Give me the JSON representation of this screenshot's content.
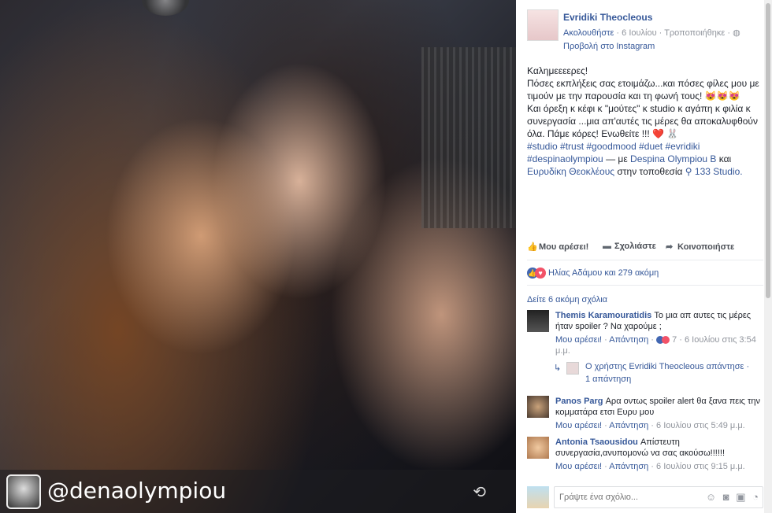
{
  "photo": {
    "watermark_handle": "@denaolympiou"
  },
  "header": {
    "page_name": "Evridiki Theocleous",
    "follow": "Ακολουθήστε",
    "date": "6 Ιουλίου",
    "edited": "Τροποποιήθηκε",
    "instagram_link": "Προβολή στο Instagram"
  },
  "post": {
    "line1": "Καλημεεεερες!",
    "line2": "Πόσες εκπλήξεις σας ετοιμάζω...και πόσες φίλες μου με τιμούν με την παρουσία και τη φωνή τους! 😻😻😻",
    "line3": "Και όρεξη κ κέφι κ \"μούτες\" κ studio κ αγάπη κ φιλία κ συνεργασία ...μια απ'αυτές τις μέρες θα αποκαλυφθούν όλα. Πάμε κόρες! Ενωθείτε !!! ❤️ 🐰",
    "hashtags": "#studio #trust #goodmood #duet #evridiki #despinaolympiou",
    "with_prefix": "— με",
    "tag1": "Despina Olympiou B",
    "and": "και",
    "tag2": "Ευρυδίκη Θεοκλέους",
    "location_prefix": "στην τοποθεσία",
    "location": "133 Studio."
  },
  "actions": {
    "like": "Μου αρέσει!",
    "comment": "Σχολιάστε",
    "share": "Κοινοποιήστε"
  },
  "reactions_text": "Ηλίας Αδάμου και 279 ακόμη",
  "more_comments": "Δείτε 6 ακόμη σχόλια",
  "comments": [
    {
      "author": "Themis Karamouratidis",
      "text": "Το μια απ αυτες τις μέρες ήταν spoiler ? Να χαρούμε ;",
      "like": "Μου αρέσει!",
      "reply": "Απάντηση",
      "reactions": "7",
      "time": "6 Ιουλίου στις 3:54 μ.μ."
    },
    {
      "author": "Panos Parg",
      "text": "Αρα οντως spoiler alert θα ξανα πεις την κομματάρα ετσι Ευρυ μου",
      "like": "Μου αρέσει!",
      "reply": "Απάντηση",
      "time": "6 Ιουλίου στις 5:49 μ.μ."
    },
    {
      "author": "Antonia Tsaousidou",
      "text": "Απίστευτη συνεργασία,ανυπομονώ να σας ακούσω!!!!!!",
      "like": "Μου αρέσει!",
      "reply": "Απάντηση",
      "time": "6 Ιουλίου στις 9:15 μ.μ."
    }
  ],
  "reply_thread": {
    "text": "Ο χρήστης Evridiki Theocleous απάντησε · 1 απάντηση"
  },
  "composer": {
    "placeholder": "Γράψτε ένα σχόλιο..."
  }
}
